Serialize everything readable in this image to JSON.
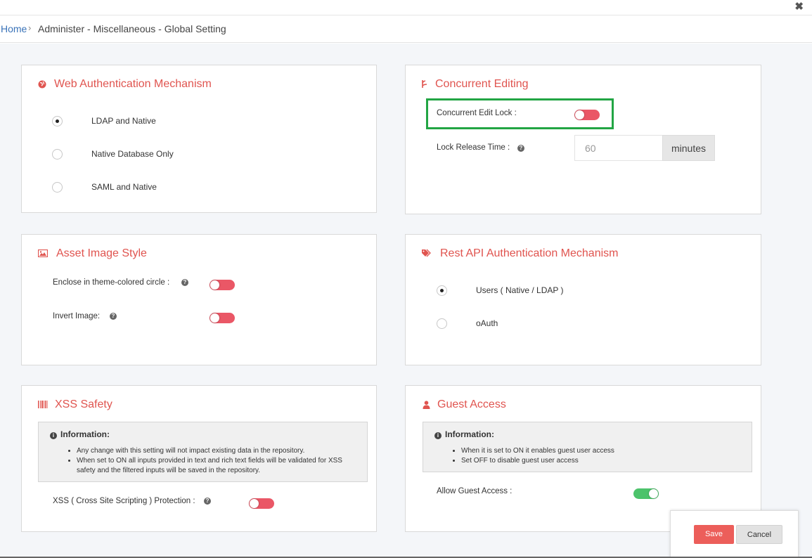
{
  "window": {
    "close_label": "✖"
  },
  "breadcrumb": {
    "home": "Home",
    "separator": "›",
    "path": "Administer - Miscellaneous - Global Setting"
  },
  "web_auth": {
    "title": "Web Authentication Mechanism",
    "icon": "globe-icon",
    "options": [
      {
        "label": "LDAP and Native",
        "selected": true
      },
      {
        "label": "Native Database Only",
        "selected": false
      },
      {
        "label": "SAML and Native",
        "selected": false
      }
    ]
  },
  "concurrent": {
    "title": "Concurrent Editing",
    "icon": "branch-icon",
    "edit_lock_label": "Concurrent Edit Lock :",
    "edit_lock_on": false,
    "release_label": "Lock Release Time :",
    "release_placeholder": "60",
    "release_unit": "minutes"
  },
  "asset_image": {
    "title": "Asset Image Style",
    "icon": "image-icon",
    "enclose_label": "Enclose in theme-colored circle :",
    "enclose_on": false,
    "invert_label": "Invert Image:",
    "invert_on": false
  },
  "rest_api": {
    "title": "Rest API Authentication Mechanism",
    "icon": "tags-icon",
    "options": [
      {
        "label": "Users ( Native / LDAP )",
        "selected": true
      },
      {
        "label": "oAuth",
        "selected": false
      }
    ]
  },
  "xss": {
    "title": "XSS Safety",
    "icon": "barcode-icon",
    "info_title": "Information:",
    "info_items": [
      "Any change with this setting will not impact existing data in the repository.",
      "When set to ON all inputs provided in text and rich text fields will be validated for XSS safety and the filtered inputs will be saved in the repository."
    ],
    "protection_label": "XSS ( Cross Site Scripting ) Protection :",
    "protection_on": false
  },
  "guest": {
    "title": "Guest Access",
    "icon": "user-icon",
    "info_title": "Information:",
    "info_items": [
      "When it is set to ON it enables guest user access",
      "Set OFF to disable guest user access"
    ],
    "allow_label": "Allow Guest Access :",
    "allow_on": true
  },
  "footer": {
    "save": "Save",
    "cancel": "Cancel"
  },
  "colors": {
    "accent": "#e0544f",
    "toggle_off": "#ea5766",
    "toggle_on": "#4cc36b",
    "highlight": "#22a544",
    "link": "#3a73b8"
  }
}
